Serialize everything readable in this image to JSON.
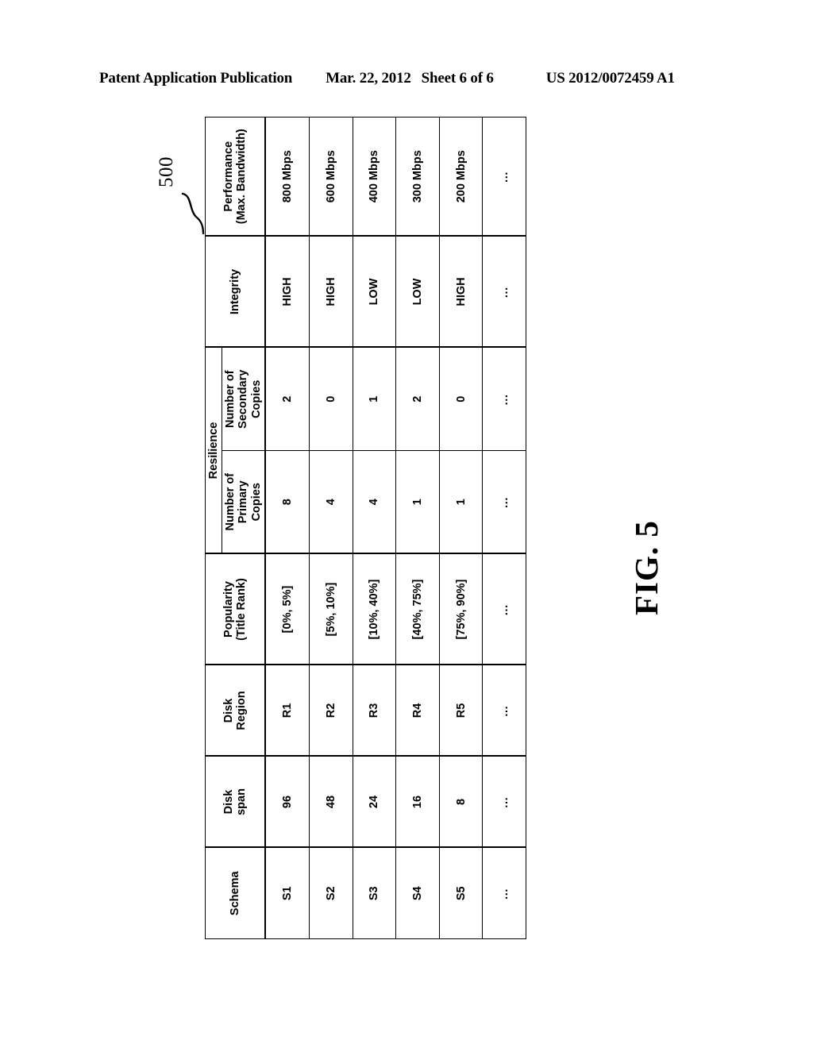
{
  "page_header": {
    "publication": "Patent Application Publication",
    "date": "Mar. 22, 2012",
    "sheet": "Sheet 6 of 6",
    "patent_number": "US 2012/0072459 A1"
  },
  "figure": {
    "caption": "FIG. 5",
    "reference_numeral": "500"
  },
  "table": {
    "headers": {
      "schema": "Schema",
      "disk_span": "Disk\nspan",
      "disk_span_line1": "Disk",
      "disk_span_line2": "span",
      "disk_region_line1": "Disk",
      "disk_region_line2": "Region",
      "popularity_line1": "Popularity",
      "popularity_line2": "(Title Rank)",
      "resilience": "Resilience",
      "primary_line1": "Number of",
      "primary_line2": "Primary",
      "primary_line3": "Copies",
      "secondary_line1": "Number of",
      "secondary_line2": "Secondary",
      "secondary_line3": "Copies",
      "integrity": "Integrity",
      "performance_line1": "Performance",
      "performance_line2": "(Max. Bandwidth)"
    },
    "rows": [
      {
        "schema": "S1",
        "disk_span": "96",
        "disk_region": "R1",
        "popularity": "[0%,  5%]",
        "primary_copies": "8",
        "secondary_copies": "2",
        "integrity": "HIGH",
        "performance": "800 Mbps"
      },
      {
        "schema": "S2",
        "disk_span": "48",
        "disk_region": "R2",
        "popularity": "[5%,  10%]",
        "primary_copies": "4",
        "secondary_copies": "0",
        "integrity": "HIGH",
        "performance": "600 Mbps"
      },
      {
        "schema": "S3",
        "disk_span": "24",
        "disk_region": "R3",
        "popularity": "[10%,  40%]",
        "primary_copies": "4",
        "secondary_copies": "1",
        "integrity": "LOW",
        "performance": "400 Mbps"
      },
      {
        "schema": "S4",
        "disk_span": "16",
        "disk_region": "R4",
        "popularity": "[40%,  75%]",
        "primary_copies": "1",
        "secondary_copies": "2",
        "integrity": "LOW",
        "performance": "300 Mbps"
      },
      {
        "schema": "S5",
        "disk_span": "8",
        "disk_region": "R5",
        "popularity": "[75%,  90%]",
        "primary_copies": "1",
        "secondary_copies": "0",
        "integrity": "HIGH",
        "performance": "200 Mbps"
      },
      {
        "schema": "…",
        "disk_span": "…",
        "disk_region": "…",
        "popularity": "…",
        "primary_copies": "…",
        "secondary_copies": "…",
        "integrity": "…",
        "performance": "…"
      }
    ]
  }
}
